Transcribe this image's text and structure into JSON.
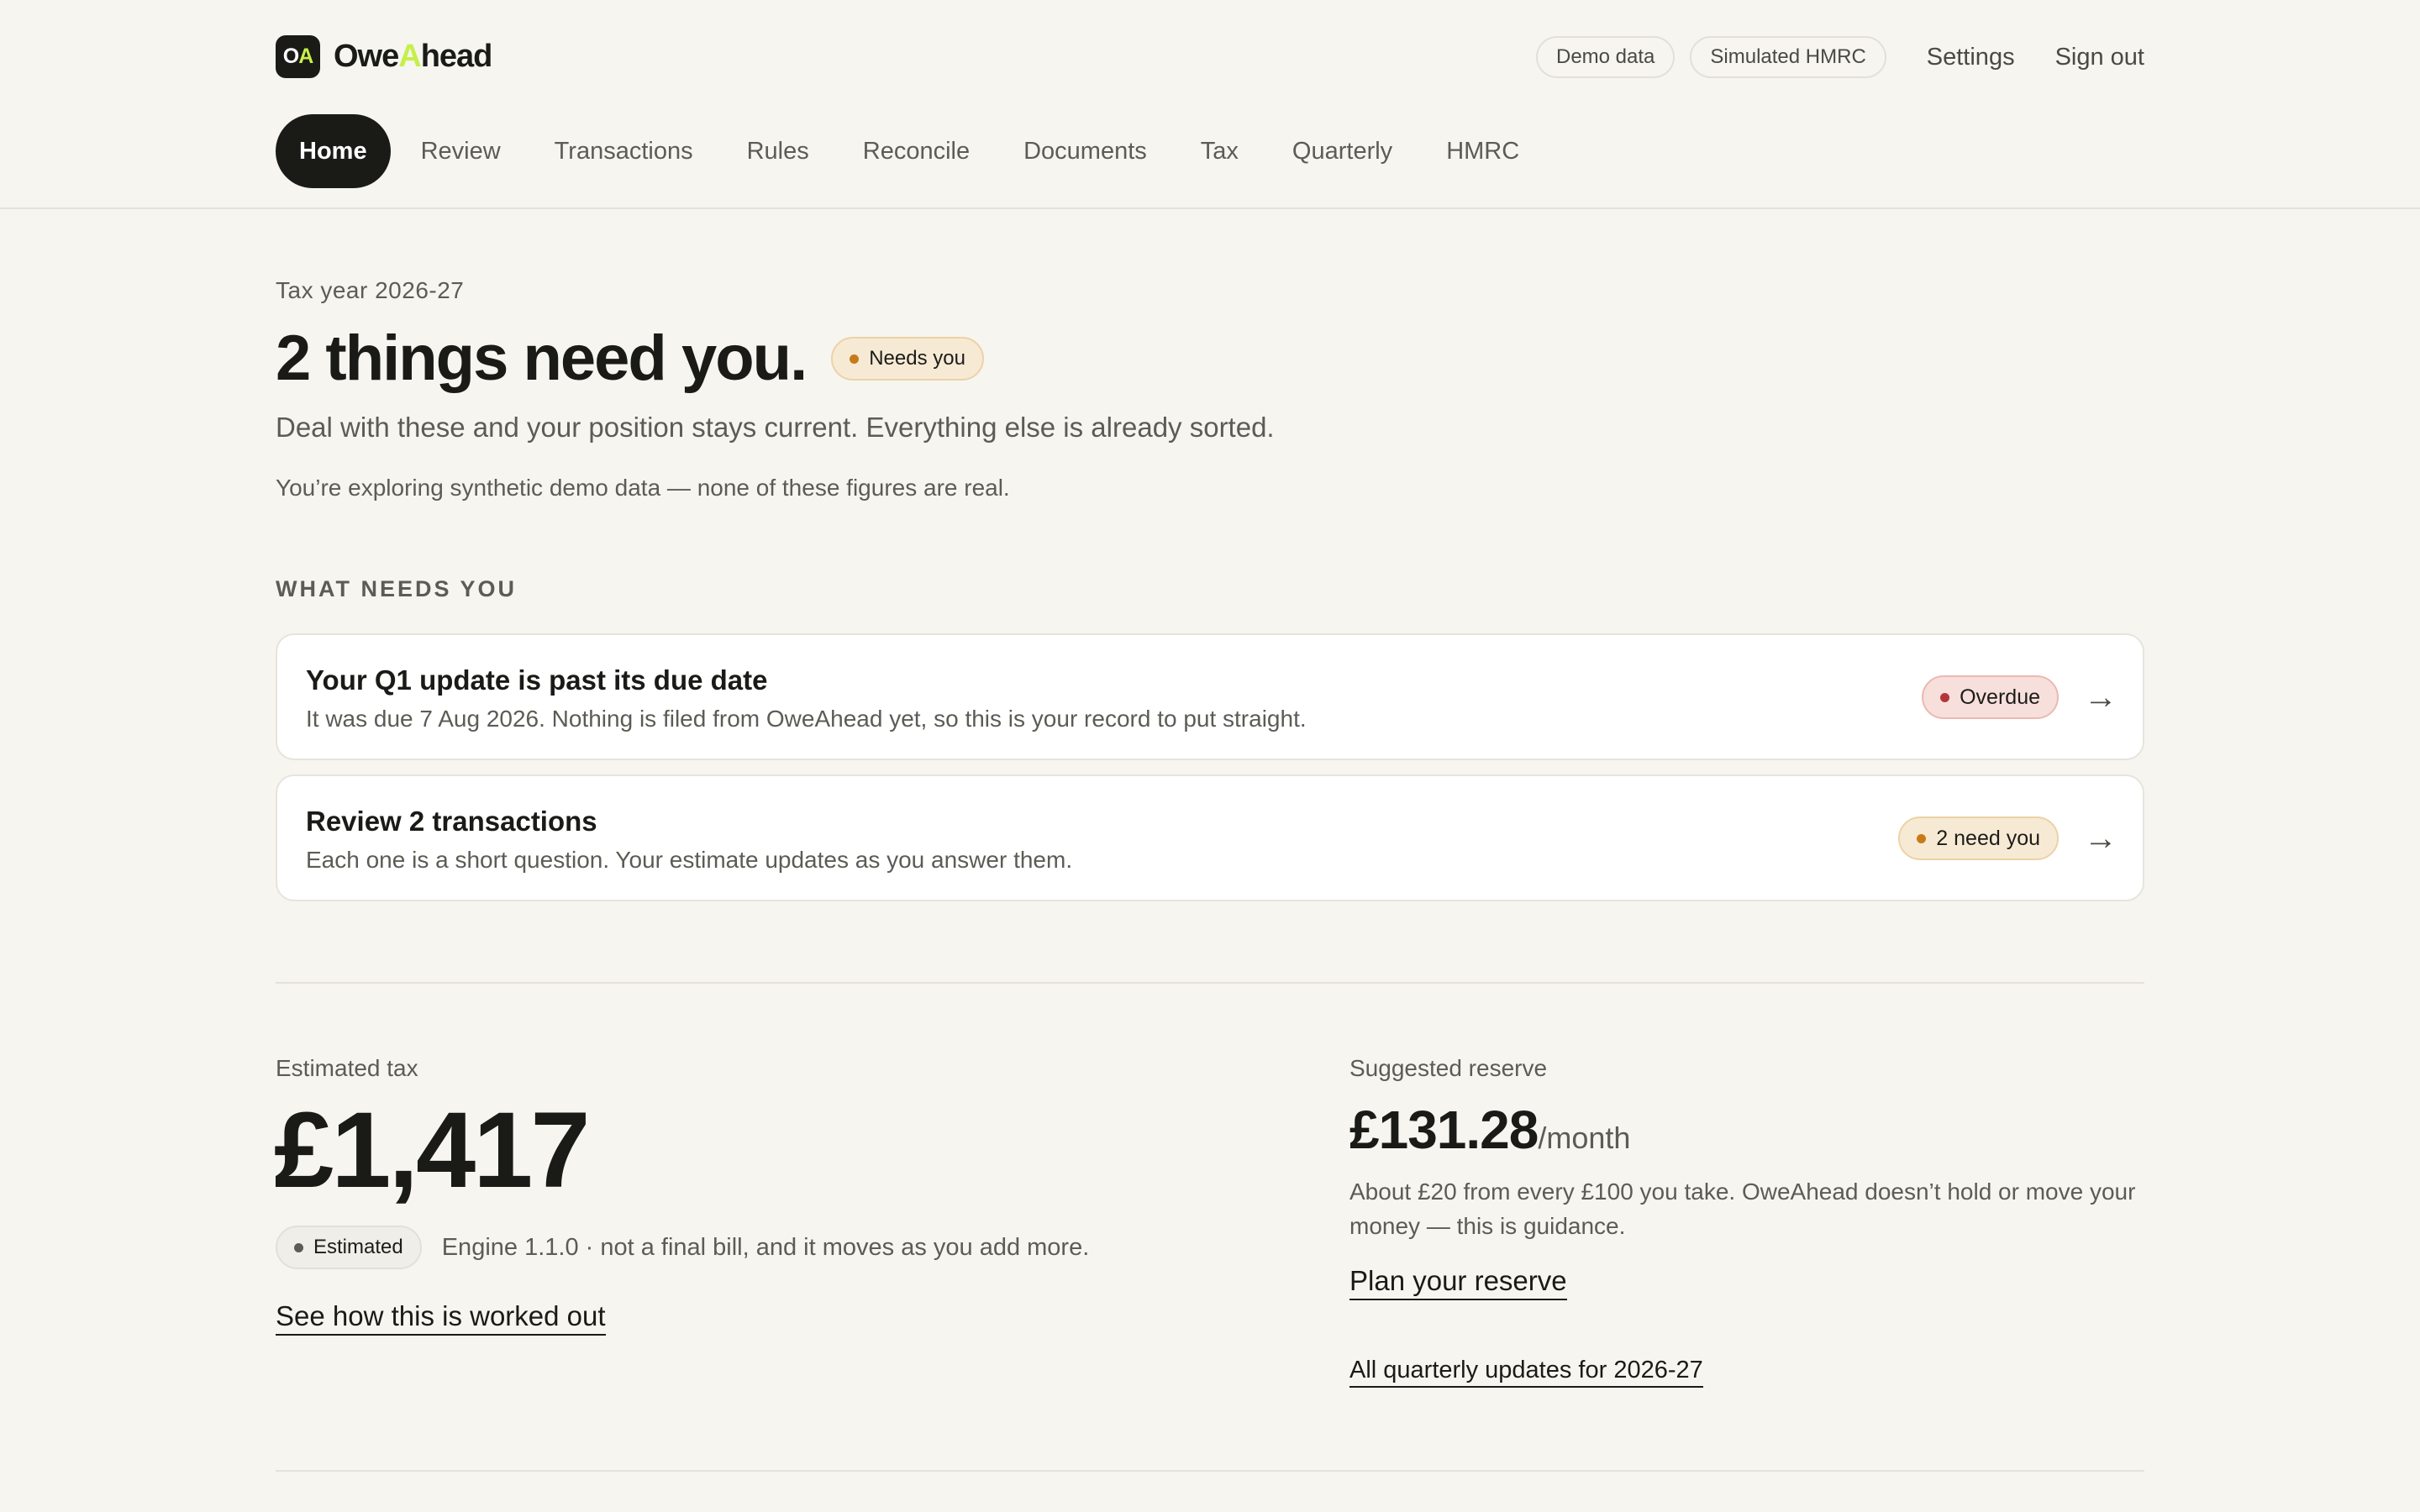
{
  "brand": {
    "mark_left": "O",
    "mark_right": "A",
    "name_pre": "Owe",
    "name_accent": "A",
    "name_post": "head"
  },
  "header": {
    "chips": [
      "Demo data",
      "Simulated HMRC"
    ],
    "settings_label": "Settings",
    "signout_label": "Sign out"
  },
  "nav": {
    "items": [
      {
        "label": "Home",
        "active": true
      },
      {
        "label": "Review"
      },
      {
        "label": "Transactions"
      },
      {
        "label": "Rules"
      },
      {
        "label": "Reconcile"
      },
      {
        "label": "Documents"
      },
      {
        "label": "Tax"
      },
      {
        "label": "Quarterly"
      },
      {
        "label": "HMRC"
      }
    ]
  },
  "intro": {
    "tax_year": "Tax year 2026-27",
    "headline": "2 things need you.",
    "status": "Needs you",
    "lede": "Deal with these and your position stays current. Everything else is already sorted.",
    "note": "You’re exploring synthetic demo data — none of these figures are real."
  },
  "needs": {
    "section_label": "WHAT NEEDS YOU",
    "items": [
      {
        "title": "Your Q1 update is past its due date",
        "desc": "It was due 7 Aug 2026. Nothing is filed from OweAhead yet, so this is your record to put straight.",
        "badge": "Overdue",
        "arrow": "→"
      },
      {
        "title": "Review 2 transactions",
        "desc": "Each one is a short question. Your estimate updates as you answer them.",
        "badge": "2 need you",
        "arrow": "→"
      }
    ]
  },
  "estimate": {
    "label": "Estimated tax",
    "amount": "£1,417",
    "badge": "Estimated",
    "note": "Engine 1.1.0 · not a final bill, and it moves as you add more.",
    "link": "See how this is worked out"
  },
  "reserve": {
    "label": "Suggested reserve",
    "amount": "£131.28",
    "per": "/month",
    "desc": "About £20 from every £100 you take. OweAhead doesn’t hold or move your money — this is guidance.",
    "link": "Plan your reserve",
    "link2": "All quarterly updates for 2026-27"
  },
  "colors": {
    "background": "#f6f5f0",
    "ink": "#1a1b17",
    "accent": "#c6ef4a",
    "amber": "#c87a18",
    "red": "#b3353a"
  }
}
